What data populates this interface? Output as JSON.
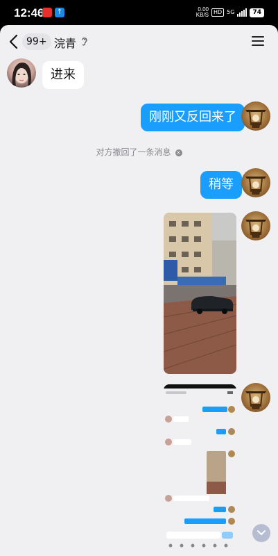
{
  "status": {
    "time": "12:46",
    "speed": "0.00\nKB/S",
    "hd": "HD",
    "network": "5G",
    "battery": "74"
  },
  "header": {
    "unread_badge": "99+",
    "contact_name": "浣青"
  },
  "messages": [
    {
      "side": "incoming",
      "type": "text",
      "text": "进来"
    },
    {
      "side": "outgoing",
      "type": "text",
      "text": "刚刚又反回来了"
    },
    {
      "side": "system",
      "type": "recall",
      "text": "对方撤回了一条消息"
    },
    {
      "side": "outgoing",
      "type": "text",
      "text": "稍等"
    },
    {
      "side": "outgoing",
      "type": "image",
      "content": "street photo"
    },
    {
      "side": "outgoing",
      "type": "image",
      "content": "chat screenshot"
    }
  ],
  "icons": {
    "back": "chevron-left-icon",
    "earpiece": "ear-icon",
    "menu": "hamburger-menu-icon",
    "scroll": "chevron-down-icon"
  },
  "colors": {
    "outgoing_bubble": "#1a9efd",
    "incoming_bubble": "#ffffff",
    "chat_background": "#f0f0f3"
  }
}
